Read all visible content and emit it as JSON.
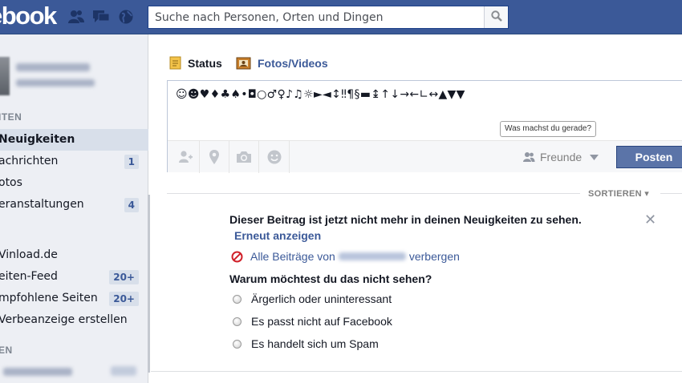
{
  "header": {
    "logo": "ebook",
    "search_placeholder": "Suche nach Personen, Orten und Dingen",
    "icons": [
      "friend-requests-icon",
      "messages-icon",
      "notifications-globe-icon",
      "search-icon"
    ],
    "brand_color": "#3b5998"
  },
  "sidebar": {
    "section1_head": "ITEN",
    "items": [
      {
        "label": "Neuigkeiten",
        "badge": "",
        "active": true
      },
      {
        "label": "achrichten",
        "badge": "1"
      },
      {
        "label": "otos",
        "badge": ""
      },
      {
        "label": "eranstaltungen",
        "badge": "4"
      },
      {
        "label": "Vinload.de",
        "badge": ""
      },
      {
        "label": "eiten-Feed",
        "badge": "20+"
      },
      {
        "label": "mpfohlene Seiten",
        "badge": "20+"
      },
      {
        "label": "Verbeanzeige erstellen",
        "badge": ""
      }
    ],
    "section2_head": "EN"
  },
  "composer": {
    "tab_status": "Status",
    "tab_photos": "Fotos/Videos",
    "text": "☺☻♥♦♣♠•◘○♂♀♪♫☼►◄↕‼¶§▬↨↑↓→←∟↔▲▼▼",
    "tooltip": "Was machst du gerade?",
    "audience": "Freunde",
    "post_label": "Posten",
    "footer_icons": [
      "tag-friends-icon",
      "location-pin-icon",
      "camera-icon",
      "smiley-icon"
    ]
  },
  "feed": {
    "sort_label": "SORTIEREN ▾",
    "hidden_notice": "Dieser Beitrag ist jetzt nicht mehr in deinen Neuigkeiten zu sehen.",
    "restore_link": "Erneut anzeigen",
    "hide_all_prefix": "Alle Beiträge von",
    "hide_all_suffix": "verbergen",
    "question": "Warum möchtest du das nicht sehen?",
    "options": [
      "Ärgerlich oder uninteressant",
      "Es passt nicht auf Facebook",
      "Es handelt sich um Spam"
    ],
    "close": "✕"
  }
}
